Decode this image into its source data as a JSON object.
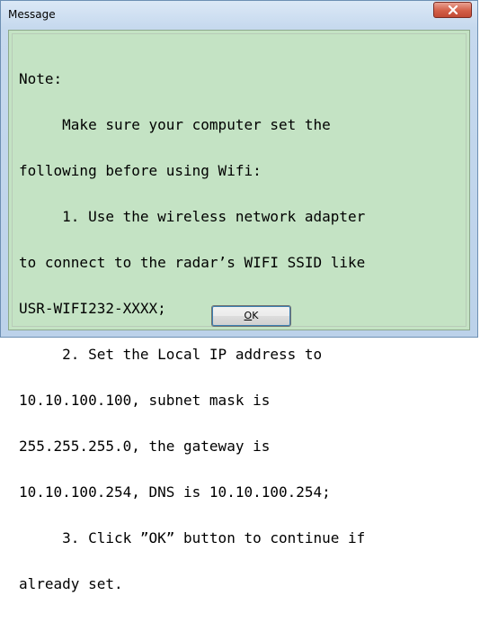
{
  "window": {
    "title": "Message",
    "close_icon": "close-x-icon",
    "close_color": "#c94c36"
  },
  "message": {
    "lines": [
      "Note:",
      "     Make sure your computer set the",
      "following before using Wifi:",
      "     1. Use the wireless network adapter",
      "to connect to the radar’s WIFI SSID like",
      "USR-WIFI232-XXXX;",
      "     2. Set the Local IP address to",
      "10.10.100.100, subnet mask is",
      "255.255.255.0, the gateway is",
      "10.10.100.254, DNS is 10.10.100.254;",
      "     3. Click ”OK” button to continue if",
      "already set."
    ],
    "background": "#c4e3c4"
  },
  "buttons": {
    "ok_mnemonic": "O",
    "ok_rest": "K"
  }
}
